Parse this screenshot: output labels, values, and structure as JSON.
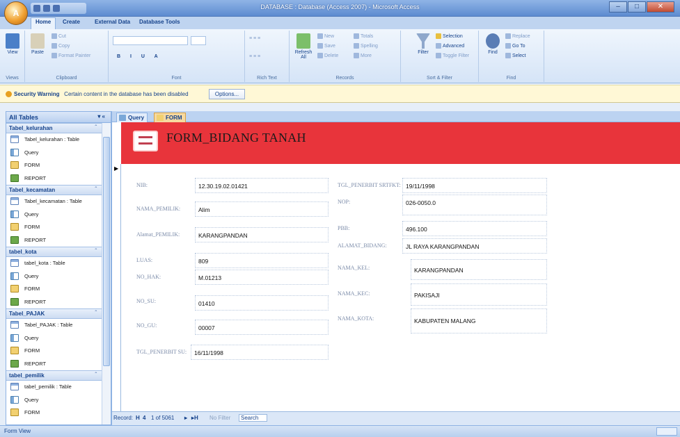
{
  "window": {
    "title": "DATABASE : Database (Access 2007) - Microsoft Access"
  },
  "tabs": [
    "Home",
    "Create",
    "External Data",
    "Database Tools"
  ],
  "ribbon": {
    "views": {
      "label": "Views",
      "view_btn": "View"
    },
    "clipboard": {
      "label": "Clipboard",
      "paste": "Paste",
      "cut": "Cut",
      "copy": "Copy",
      "format_painter": "Format Painter"
    },
    "font": {
      "label": "Font"
    },
    "rich_text": {
      "label": "Rich Text"
    },
    "records": {
      "label": "Records",
      "refresh": "Refresh All",
      "new": "New",
      "save": "Save",
      "delete": "Delete",
      "totals": "Totals",
      "spelling": "Spelling",
      "more": "More"
    },
    "sort_filter": {
      "label": "Sort & Filter",
      "filter": "Filter",
      "selection": "Selection",
      "advanced": "Advanced",
      "toggle_filter": "Toggle Filter"
    },
    "find": {
      "label": "Find",
      "find": "Find",
      "replace": "Replace",
      "goto": "Go To",
      "select": "Select"
    }
  },
  "security": {
    "title": "Security Warning",
    "message": "Certain content in the database has been disabled",
    "options": "Options..."
  },
  "nav": {
    "header": "All Tables",
    "groups": [
      {
        "name": "Tabel_kelurahan",
        "items": [
          {
            "type": "table",
            "label": "Tabel_kelurahan : Table"
          },
          {
            "type": "query",
            "label": "Query"
          },
          {
            "type": "form",
            "label": "FORM"
          },
          {
            "type": "report",
            "label": "REPORT"
          }
        ]
      },
      {
        "name": "Tabel_kecamatan",
        "items": [
          {
            "type": "table",
            "label": "Tabel_kecamatan : Table"
          },
          {
            "type": "query",
            "label": "Query"
          },
          {
            "type": "form",
            "label": "FORM"
          },
          {
            "type": "report",
            "label": "REPORT"
          }
        ]
      },
      {
        "name": "tabel_kota",
        "items": [
          {
            "type": "table",
            "label": "tabel_kota : Table"
          },
          {
            "type": "query",
            "label": "Query"
          },
          {
            "type": "form",
            "label": "FORM"
          },
          {
            "type": "report",
            "label": "REPORT"
          }
        ]
      },
      {
        "name": "Tabel_PAJAK",
        "items": [
          {
            "type": "table",
            "label": "Tabel_PAJAK : Table"
          },
          {
            "type": "query",
            "label": "Query"
          },
          {
            "type": "form",
            "label": "FORM"
          },
          {
            "type": "report",
            "label": "REPORT"
          }
        ]
      },
      {
        "name": "tabel_pemilik",
        "items": [
          {
            "type": "table",
            "label": "tabel_pemilik : Table"
          },
          {
            "type": "query",
            "label": "Query"
          },
          {
            "type": "form",
            "label": "FORM"
          }
        ]
      }
    ]
  },
  "doc_tabs": [
    "Query",
    "FORM"
  ],
  "form": {
    "title": "FORM_BIDANG TANAH",
    "left": {
      "nib_label": "NIB:",
      "nib": "12.30.19.02.01421",
      "nama_pemilik_label": "NAMA_PEMILIK:",
      "nama_pemilik": "Alim",
      "alamat_pemilik_label": "Alamat_PEMILIK:",
      "alamat_pemilik": "KARANGPANDAN",
      "luas_label": "LUAS:",
      "luas": "809",
      "no_hak_label": "NO_HAK:",
      "no_hak": "M.01213",
      "no_su_label": "NO_SU:",
      "no_su": "01410",
      "no_gu_label": "NO_GU:",
      "no_gu": "00007",
      "tgl_su_label": "TGL_PENERBIT SU:",
      "tgl_su": "16/11/1998"
    },
    "right": {
      "tgl_sertifikat_label": "TGL_PENERBIT SRTFKT:",
      "tgl_sertifikat": "19/11/1998",
      "nop_label": "NOP:",
      "nop": "026-0050.0",
      "pbb_label": "PBB:",
      "pbb": "496.100",
      "alamat_bidang_label": "ALAMAT_BIDANG:",
      "alamat_bidang": "JL RAYA KARANGPANDAN",
      "nama_kel_label": "NAMA_KEL:",
      "nama_kel": "KARANGPANDAN",
      "nama_kec_label": "NAMA_KEC:",
      "nama_kec": "PAKISAJI",
      "nama_kota_label": "NAMA_KOTA:",
      "nama_kota": "KABUPATEN MALANG"
    }
  },
  "record_nav": {
    "label": "Record:",
    "first": "H",
    "prev": "4",
    "position": "1 of 5061",
    "next": "▸",
    "last": "▸H",
    "filter": "No Filter",
    "search": "Search"
  },
  "status": {
    "text": "Form View"
  }
}
